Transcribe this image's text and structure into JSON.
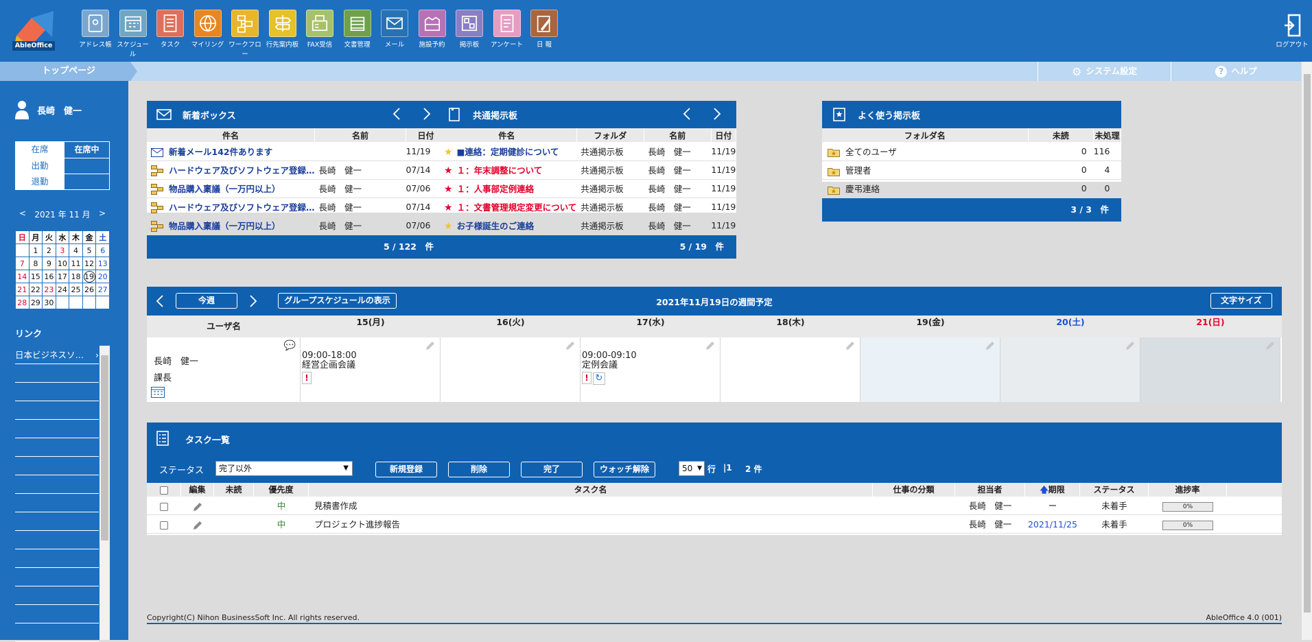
{
  "apps": [
    {
      "label": "アドレス帳",
      "icon": "address-book-icon",
      "color": "#7aa7cf"
    },
    {
      "label": "スケジュール",
      "icon": "calendar-icon",
      "color": "#6fa6c4"
    },
    {
      "label": "タスク",
      "icon": "task-icon",
      "color": "#df6f5a"
    },
    {
      "label": "マイリング",
      "icon": "globe-icon",
      "color": "#e8871f"
    },
    {
      "label": "ワークフロー",
      "icon": "workflow-icon",
      "color": "#e8b62b"
    },
    {
      "label": "行先案内板",
      "icon": "signpost-icon",
      "color": "#e5c12a"
    },
    {
      "label": "FAX受信",
      "icon": "fax-icon",
      "color": "#a7c16b"
    },
    {
      "label": "文書管理",
      "icon": "document-icon",
      "color": "#6fa14d"
    },
    {
      "label": "メール",
      "icon": "mail-icon",
      "color": "#2573b5"
    },
    {
      "label": "施設予約",
      "icon": "facility-icon",
      "color": "#b771b5"
    },
    {
      "label": "掲示板",
      "icon": "board-icon",
      "color": "#8a7ec5"
    },
    {
      "label": "アンケート",
      "icon": "survey-icon",
      "color": "#e79cc2"
    },
    {
      "label": "日 報",
      "icon": "report-icon",
      "color": "#a8663f"
    }
  ],
  "logo": "AbleOffice",
  "logout": "ログアウト",
  "breadcrumb": {
    "home": "トップページ",
    "system": "システム設定",
    "help": "ヘルプ"
  },
  "sidebar": {
    "user": "長崎　健一",
    "attendance": [
      {
        "label": "在席",
        "value": "在席中"
      },
      {
        "label": "出勤",
        "value": ""
      },
      {
        "label": "退勤",
        "value": ""
      }
    ],
    "calendar": {
      "title": "2021 年 11 月",
      "weekdays": [
        "日",
        "月",
        "火",
        "水",
        "木",
        "金",
        "土"
      ],
      "weeks": [
        [
          "",
          "1",
          "2",
          "3",
          "4",
          "5",
          "6"
        ],
        [
          "7",
          "8",
          "9",
          "10",
          "11",
          "12",
          "13"
        ],
        [
          "14",
          "15",
          "16",
          "17",
          "18",
          "19",
          "20"
        ],
        [
          "21",
          "22",
          "23",
          "24",
          "25",
          "26",
          "27"
        ],
        [
          "28",
          "29",
          "30",
          "",
          "",
          "",
          ""
        ]
      ],
      "today": "19"
    },
    "links_title": "リンク",
    "links": [
      "日本ビジネスソ…",
      "",
      "",
      "",
      "",
      "",
      "",
      "",
      "",
      "",
      "",
      "",
      "",
      "",
      "",
      ""
    ]
  },
  "inbox": {
    "title": "新着ボックス",
    "cols": [
      "件名",
      "名前",
      "日付"
    ],
    "rows": [
      {
        "subject": "新着メール142件あります",
        "name": "",
        "date": "11/19",
        "icon": "mail-icon"
      },
      {
        "subject": "ハードウェア及びソフトウェア登録…",
        "name": "長崎　健一",
        "date": "07/14",
        "icon": "workflow-icon"
      },
      {
        "subject": "物品購入稟議（一万円以上）",
        "name": "長崎　健一",
        "date": "07/06",
        "icon": "workflow-icon"
      },
      {
        "subject": "ハードウェア及びソフトウェア登録…",
        "name": "長崎　健一",
        "date": "07/14",
        "icon": "workflow-icon"
      },
      {
        "subject": "物品購入稟議（一万円以上）",
        "name": "長崎　健一",
        "date": "07/06",
        "icon": "workflow-icon"
      }
    ],
    "footer": "5 / 122　件"
  },
  "board": {
    "title": "共通掲示板",
    "cols": [
      "件名",
      "フォルダ",
      "名前",
      "日付"
    ],
    "rows": [
      {
        "subject": "■連絡：定期健診について",
        "folder": "共通掲示板",
        "name": "長崎　健一",
        "date": "11/19",
        "star": "#f1c232",
        "style": "lnk"
      },
      {
        "subject": "１：年末調整について",
        "folder": "共通掲示板",
        "name": "長崎　健一",
        "date": "11/19",
        "star": "#e4002b",
        "style": "red"
      },
      {
        "subject": "１：人事部定例連絡",
        "folder": "共通掲示板",
        "name": "長崎　健一",
        "date": "11/19",
        "star": "#e4002b",
        "style": "red"
      },
      {
        "subject": "１：文書管理規定変更について",
        "folder": "共通掲示板",
        "name": "長崎　健一",
        "date": "11/19",
        "star": "#e4002b",
        "style": "red"
      },
      {
        "subject": "お子様誕生のご連絡",
        "folder": "共通掲示板",
        "name": "長崎　健一",
        "date": "11/19",
        "star": "#f1c232",
        "style": "lnk"
      }
    ],
    "footer": "5 / 19　件"
  },
  "fav": {
    "title": "よく使う掲示板",
    "cols": [
      "フォルダ名",
      "未読",
      "未処理"
    ],
    "rows": [
      {
        "folder": "全てのユーザ",
        "unread": "0",
        "pending": "116"
      },
      {
        "folder": "管理者",
        "unread": "0",
        "pending": "4"
      },
      {
        "folder": "慶弔連絡",
        "unread": "0",
        "pending": "0"
      }
    ],
    "footer": "3 / 3　件"
  },
  "schedule": {
    "this_week": "今週",
    "group": "グループスケジュールの表示",
    "title": "2021年11月19日の週間予定",
    "font_size": "文字サイズ",
    "user_col": "ユーザ名",
    "days": [
      "15(月)",
      "16(火)",
      "17(水)",
      "18(木)",
      "19(金)",
      "20(土)",
      "21(日)"
    ],
    "user": {
      "name": "長崎　健一",
      "role": "課長"
    },
    "events": [
      {
        "day": 0,
        "time": "09:00-18:00",
        "title": "経営企画会議",
        "repeat": false
      },
      {
        "day": 2,
        "time": "09:00-09:10",
        "title": "定例会議",
        "repeat": true
      }
    ]
  },
  "tasks": {
    "title": "タスク一覧",
    "status_label": "ステータス",
    "status_value": "完了以外",
    "buttons": [
      "新規登録",
      "削除",
      "完了",
      "ウォッチ解除"
    ],
    "rows_value": "50",
    "rows_label": "行",
    "page": "|1",
    "count": "2 件",
    "cols": [
      "編集",
      "未読",
      "優先度",
      "タスク名",
      "仕事の分類",
      "担当者",
      "期限",
      "ステータス",
      "進捗率"
    ],
    "rows": [
      {
        "priority": "中",
        "name": "見積書作成",
        "category": "",
        "assignee": "長崎　健一",
        "due": "ー",
        "status": "未着手",
        "progress": "0%"
      },
      {
        "priority": "中",
        "name": "プロジェクト進捗報告",
        "category": "",
        "assignee": "長崎　健一",
        "due": "2021/11/25",
        "status": "未着手",
        "progress": "0%"
      }
    ]
  },
  "footer": {
    "copyright": "Copyright(C) Nihon BusinessSoft Inc. All rights reserved.",
    "version": "AbleOffice 4.0 (001)"
  }
}
